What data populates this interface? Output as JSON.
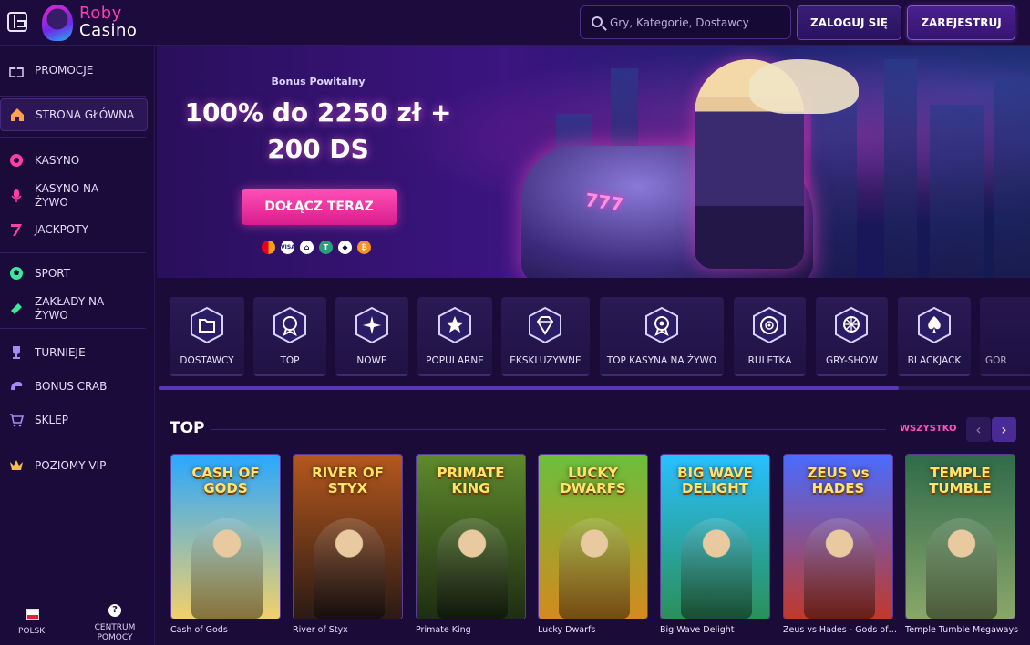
{
  "brand": {
    "name_line1": "Roby",
    "name_line2": "Casino"
  },
  "search": {
    "placeholder": "Gry, Kategorie, Dostawcy"
  },
  "auth": {
    "login_label": "ZALOGUJ SIĘ",
    "register_label": "ZAREJESTRUJ"
  },
  "sidebar": {
    "items": [
      {
        "label": "PROMOCJE",
        "icon": "gift-icon"
      },
      {
        "label": "STRONA GŁÓWNA",
        "icon": "home-icon",
        "active": true
      },
      {
        "label": "KASYNO",
        "icon": "chip-icon"
      },
      {
        "label": "KASYNO NA ŻYWO",
        "icon": "microphone-icon"
      },
      {
        "label": "JACKPOTY",
        "icon": "seven-icon"
      },
      {
        "label": "SPORT",
        "icon": "football-icon"
      },
      {
        "label": "ZAKŁADY NA ŻYWO",
        "icon": "ticket-icon"
      },
      {
        "label": "TURNIEJE",
        "icon": "trophy-icon"
      },
      {
        "label": "BONUS CRAB",
        "icon": "crab-icon"
      },
      {
        "label": "SKLEP",
        "icon": "cart-icon"
      },
      {
        "label": "POZIOMY VIP",
        "icon": "crown-icon"
      }
    ],
    "footer": {
      "language": "POLSKI",
      "help": "CENTRUM POMOCY"
    }
  },
  "hero": {
    "subtitle": "Bonus Powitalny",
    "headline_line1": "100% do 2250 zł +",
    "headline_line2": "200 DS",
    "cta": "DOŁĄCZ TERAZ",
    "plate": "777",
    "payments": [
      "mastercard-icon",
      "visa-icon",
      "bank-icon",
      "tether-icon",
      "ethereum-icon",
      "bitcoin-icon"
    ]
  },
  "categories": [
    {
      "label": "DOSTAWCY",
      "icon": "folder-icon"
    },
    {
      "label": "TOP",
      "icon": "badge-icon"
    },
    {
      "label": "NOWE",
      "icon": "sparkle-icon"
    },
    {
      "label": "POPULARNE",
      "icon": "star-icon"
    },
    {
      "label": "EKSKLUZYWNE",
      "icon": "diamond-icon"
    },
    {
      "label": "TOP KASYNA NA ŻYWO",
      "icon": "award-icon"
    },
    {
      "label": "RULETKA",
      "icon": "roulette-icon"
    },
    {
      "label": "GRY-SHOW",
      "icon": "wheel-icon"
    },
    {
      "label": "BLACKJACK",
      "icon": "spade-icon"
    },
    {
      "label": "GOR",
      "icon": "more-icon"
    }
  ],
  "top_games": {
    "title": "TOP",
    "see_all": "WSZYSTKO",
    "games": [
      {
        "name": "Cash of Gods",
        "logo": "CASH OF GODS",
        "colors": [
          "#2aa7ff",
          "#f2d06b"
        ]
      },
      {
        "name": "River of Styx",
        "logo": "RIVER OF STYX",
        "colors": [
          "#b5581e",
          "#2b1a14"
        ]
      },
      {
        "name": "Primate King",
        "logo": "PRIMATE KING",
        "colors": [
          "#5e8a2c",
          "#1e2d12"
        ]
      },
      {
        "name": "Lucky Dwarfs",
        "logo": "LUCKY DWARFS",
        "colors": [
          "#6bbf3a",
          "#d38a1f"
        ]
      },
      {
        "name": "Big Wave Delight",
        "logo": "BIG WAVE DELIGHT",
        "colors": [
          "#28c0ff",
          "#2b8f5a"
        ]
      },
      {
        "name": "Zeus vs Hades - Gods of War",
        "logo": "ZEUS vs HADES",
        "colors": [
          "#4a6bff",
          "#c0392b"
        ]
      },
      {
        "name": "Temple Tumble Megaways",
        "logo": "TEMPLE TUMBLE",
        "colors": [
          "#2f6b4a",
          "#8aa66a"
        ]
      }
    ]
  }
}
